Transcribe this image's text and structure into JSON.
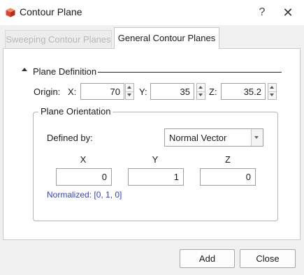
{
  "window": {
    "title": "Contour Plane",
    "help_label": "?",
    "close_label": "✕",
    "icon": "cube-app-icon"
  },
  "tabs": [
    {
      "label": "Sweeping Contour Planes",
      "state": "disabled"
    },
    {
      "label": "General Contour Planes",
      "state": "active"
    }
  ],
  "plane_definition": {
    "label": "Plane Definition",
    "origin_label": "Origin:",
    "x_label": "X:",
    "y_label": "Y:",
    "z_label": "Z:",
    "x_value": "70",
    "y_value": "35",
    "z_value": "35.2"
  },
  "orientation": {
    "group_label": "Plane Orientation",
    "defined_by_label": "Defined by:",
    "defined_by_value": "Normal Vector",
    "headers": [
      "X",
      "Y",
      "Z"
    ],
    "values": [
      "0",
      "1",
      "0"
    ],
    "normalized_text": "Normalized: [0, 1, 0]"
  },
  "buttons": {
    "add": "Add",
    "close": "Close"
  },
  "colors": {
    "normalized_text": "#2f3fcf",
    "app_icon_red": "#e0452f"
  }
}
